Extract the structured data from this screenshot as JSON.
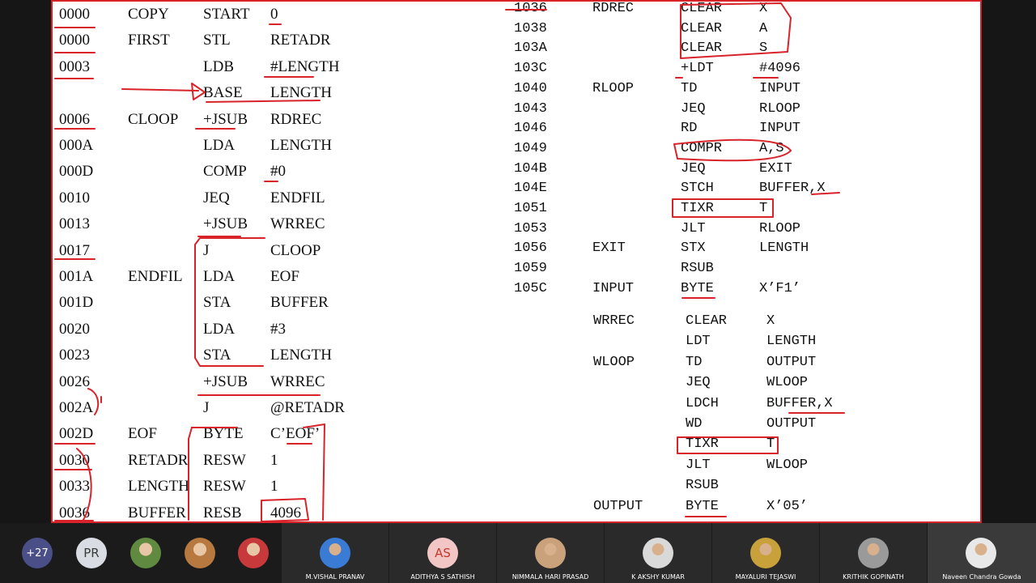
{
  "left_listing": [
    {
      "loc": "0000",
      "label": "COPY",
      "op": "START",
      "operand": "0"
    },
    {
      "loc": "0000",
      "label": "FIRST",
      "op": "STL",
      "operand": "RETADR"
    },
    {
      "loc": "0003",
      "label": "",
      "op": "LDB",
      "operand": "#LENGTH"
    },
    {
      "loc": "",
      "label": "",
      "op": "BASE",
      "operand": "LENGTH"
    },
    {
      "loc": "0006",
      "label": "CLOOP",
      "op": "+JSUB",
      "operand": "RDREC"
    },
    {
      "loc": "000A",
      "label": "",
      "op": "LDA",
      "operand": "LENGTH"
    },
    {
      "loc": "000D",
      "label": "",
      "op": "COMP",
      "operand": "#0"
    },
    {
      "loc": "0010",
      "label": "",
      "op": "JEQ",
      "operand": "ENDFIL"
    },
    {
      "loc": "0013",
      "label": "",
      "op": "+JSUB",
      "operand": "WRREC"
    },
    {
      "loc": "0017",
      "label": "",
      "op": "J",
      "operand": "CLOOP"
    },
    {
      "loc": "001A",
      "label": "ENDFIL",
      "op": "LDA",
      "operand": "EOF"
    },
    {
      "loc": "001D",
      "label": "",
      "op": "STA",
      "operand": "BUFFER"
    },
    {
      "loc": "0020",
      "label": "",
      "op": "LDA",
      "operand": "#3"
    },
    {
      "loc": "0023",
      "label": "",
      "op": "STA",
      "operand": "LENGTH"
    },
    {
      "loc": "0026",
      "label": "",
      "op": "+JSUB",
      "operand": "WRREC"
    },
    {
      "loc": "002A",
      "label": "",
      "op": "J",
      "operand": "@RETADR"
    },
    {
      "loc": "002D",
      "label": "EOF",
      "op": "BYTE",
      "operand": "C’EOF’"
    },
    {
      "loc": "0030",
      "label": "RETADR",
      "op": "RESW",
      "operand": "1"
    },
    {
      "loc": "0033",
      "label": "LENGTH",
      "op": "RESW",
      "operand": "1"
    },
    {
      "loc": "0036",
      "label": "BUFFER",
      "op": "RESB",
      "operand": "4096"
    }
  ],
  "right_listing": [
    {
      "loc": "1036",
      "label": "RDREC",
      "op": "CLEAR",
      "operand": "X"
    },
    {
      "loc": "1038",
      "label": "",
      "op": "CLEAR",
      "operand": "A"
    },
    {
      "loc": "103A",
      "label": "",
      "op": "CLEAR",
      "operand": "S"
    },
    {
      "loc": "103C",
      "label": "",
      "op": "+LDT",
      "operand": "#4096"
    },
    {
      "loc": "1040",
      "label": "RLOOP",
      "op": "TD",
      "operand": "INPUT"
    },
    {
      "loc": "1043",
      "label": "",
      "op": "JEQ",
      "operand": "RLOOP"
    },
    {
      "loc": "1046",
      "label": "",
      "op": "RD",
      "operand": "INPUT"
    },
    {
      "loc": "1049",
      "label": "",
      "op": "COMPR",
      "operand": "A,S"
    },
    {
      "loc": "104B",
      "label": "",
      "op": "JEQ",
      "operand": "EXIT"
    },
    {
      "loc": "104E",
      "label": "",
      "op": "STCH",
      "operand": "BUFFER,X"
    },
    {
      "loc": "1051",
      "label": "",
      "op": "TIXR",
      "operand": "T"
    },
    {
      "loc": "1053",
      "label": "",
      "op": "JLT",
      "operand": "RLOOP"
    },
    {
      "loc": "1056",
      "label": "EXIT",
      "op": "STX",
      "operand": "LENGTH"
    },
    {
      "loc": "1059",
      "label": "",
      "op": "RSUB",
      "operand": ""
    },
    {
      "loc": "105C",
      "label": "INPUT",
      "op": "BYTE",
      "operand": "X’F1’"
    }
  ],
  "wrrec_listing": [
    {
      "label": "WRREC",
      "op": "CLEAR",
      "operand": "X"
    },
    {
      "label": "",
      "op": "LDT",
      "operand": "LENGTH"
    },
    {
      "label": "WLOOP",
      "op": "TD",
      "operand": "OUTPUT"
    },
    {
      "label": "",
      "op": "JEQ",
      "operand": "WLOOP"
    },
    {
      "label": "",
      "op": "LDCH",
      "operand": "BUFFER,X"
    },
    {
      "label": "",
      "op": "WD",
      "operand": "OUTPUT"
    },
    {
      "label": "",
      "op": "TIXR",
      "operand": "T"
    },
    {
      "label": "",
      "op": "JLT",
      "operand": "WLOOP"
    },
    {
      "label": "",
      "op": "RSUB",
      "operand": ""
    },
    {
      "label": "OUTPUT",
      "op": "BYTE",
      "operand": "X’05’"
    }
  ],
  "participants": {
    "overflow_count": "+27",
    "initials_bubble": "PR",
    "tiles": [
      {
        "name": "M.VISHAL PRANAV",
        "kind": "photo",
        "color": "#3a7bd5"
      },
      {
        "name": "ADITHYA S SATHISH",
        "kind": "initials",
        "initials": "AS",
        "color": "#f3c6c6"
      },
      {
        "name": "NIMMALA HARI PRASAD",
        "kind": "photo",
        "color": "#c9a27c"
      },
      {
        "name": "K AKSHY KUMAR",
        "kind": "photo",
        "color": "#d9d9d9"
      },
      {
        "name": "MAYALURI TEJASWI",
        "kind": "photo",
        "color": "#c8a13a"
      },
      {
        "name": "KRITHIK GOPINATH",
        "kind": "photo",
        "color": "#9a9a9a"
      },
      {
        "name": "Naveen Chandra Gowda",
        "kind": "photo",
        "color": "#e8e8e8"
      }
    ],
    "small_avatars": [
      {
        "kind": "photo",
        "color": "#5f8a3f"
      },
      {
        "kind": "photo",
        "color": "#b7793f"
      },
      {
        "kind": "photo",
        "color": "#c7393a"
      }
    ]
  },
  "colors": {
    "ink": "#d8232a",
    "text": "#111111",
    "bar": "#1b1b1b",
    "tile": "#2a2a2a"
  }
}
